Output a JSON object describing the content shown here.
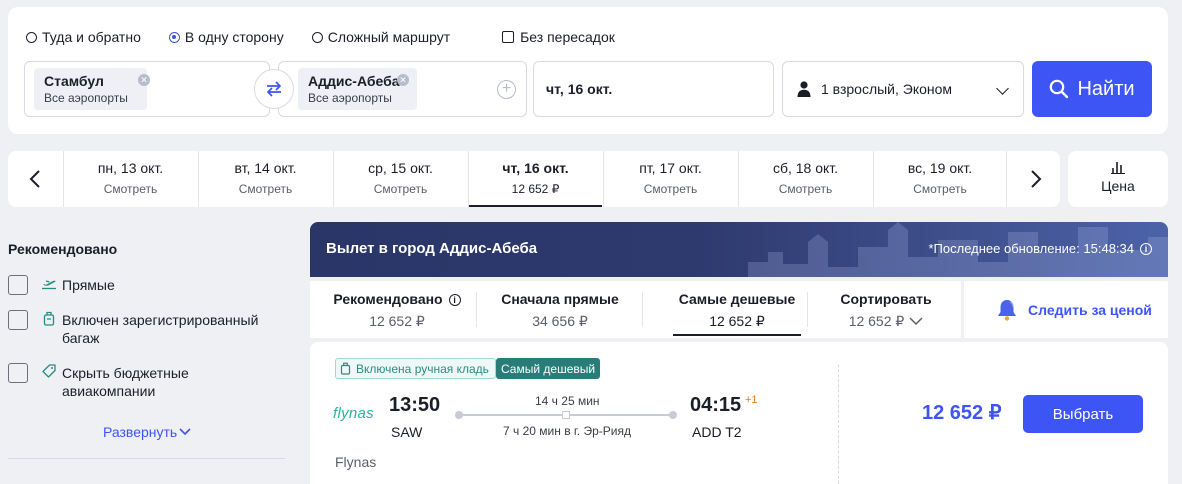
{
  "search": {
    "trip_types": [
      "Туда и обратно",
      "В одну сторону",
      "Сложный маршрут"
    ],
    "selected_trip_type": 1,
    "nonstop_label": "Без пересадок",
    "from": {
      "city": "Стамбул",
      "airports": "Все аэропорты"
    },
    "to": {
      "city": "Аддис-Абеба",
      "airports": "Все аэропорты"
    },
    "date": "чт, 16 окт.",
    "passengers": "1 взрослый, Эконом",
    "search_label": "Найти"
  },
  "date_strip": {
    "cells": [
      {
        "date": "пн, 13 окт.",
        "price": "Смотреть"
      },
      {
        "date": "вт, 14 окт.",
        "price": "Смотреть"
      },
      {
        "date": "ср, 15 окт.",
        "price": "Смотреть"
      },
      {
        "date": "чт, 16 окт.",
        "price": "12 652 ₽"
      },
      {
        "date": "пт, 17 окт.",
        "price": "Смотреть"
      },
      {
        "date": "сб, 18 окт.",
        "price": "Смотреть"
      },
      {
        "date": "вс, 19 окт.",
        "price": "Смотреть"
      }
    ],
    "active_index": 3,
    "price_tab_label": "Цена"
  },
  "filters": {
    "title": "Рекомендовано",
    "items": [
      {
        "label": "Прямые",
        "icon": "plane-takeoff-icon"
      },
      {
        "label": "Включен зарегистрированный багаж",
        "icon": "luggage-icon"
      },
      {
        "label": "Скрыть бюджетные авиакомпании",
        "icon": "tag-icon"
      }
    ],
    "expand_label": "Развернуть"
  },
  "results": {
    "banner_title": "Вылет в город Аддис-Абеба",
    "last_update": "*Последнее обновление: 15:48:34",
    "sort_options": [
      {
        "title": "Рекомендовано",
        "value": "12 652 ₽"
      },
      {
        "title": "Сначала прямые",
        "value": "34 656 ₽"
      },
      {
        "title": "Самые дешевые",
        "value": "12 652 ₽"
      },
      {
        "title": "Сортировать",
        "value": "12 652 ₽"
      }
    ],
    "active_sort_index": 2,
    "watch_price_label": "Следить за ценой"
  },
  "ticket": {
    "tag_bag": "Включена ручная кладь",
    "tag_cheapest": "Самый дешевый",
    "airline_logo": "flynas",
    "airline_name": "Flynas",
    "departure_time": "13:50",
    "departure_code": "SAW",
    "arrival_time": "04:15",
    "arrival_day_offset": "+1",
    "arrival_code": "ADD T2",
    "duration": "14 ч 25 мин",
    "stopover": "7 ч 20 мин в г. Эр-Рияд",
    "price": "12 652 ₽",
    "select_label": "Выбрать"
  },
  "colors": {
    "accent": "#3d55f5",
    "cheapest_tag": "#2a7c78",
    "banner": "#2e3a6e"
  }
}
